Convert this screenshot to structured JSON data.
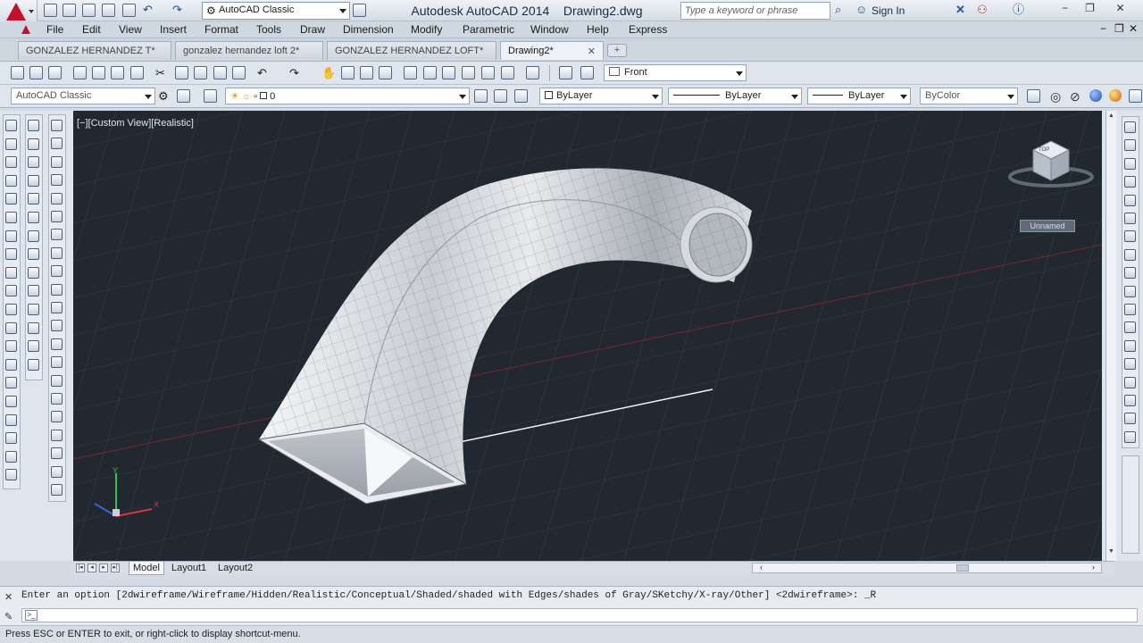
{
  "title_bar": {
    "workspace": "AutoCAD Classic",
    "app_name": "Autodesk AutoCAD 2014",
    "document": "Drawing2.dwg",
    "search_placeholder": "Type a keyword or phrase",
    "sign_in": "Sign In"
  },
  "menu": [
    "File",
    "Edit",
    "View",
    "Insert",
    "Format",
    "Tools",
    "Draw",
    "Dimension",
    "Modify",
    "Parametric",
    "Window",
    "Help",
    "Express"
  ],
  "doc_tabs": [
    {
      "label": "GONZALEZ HERNANDEZ T*",
      "active": false
    },
    {
      "label": "gonzalez hernandez loft 2*",
      "active": false
    },
    {
      "label": "GONZALEZ HERNANDEZ LOFT*",
      "active": false
    },
    {
      "label": "Drawing2*",
      "active": true
    }
  ],
  "toolbar1": {
    "view_select": "Front"
  },
  "toolbar2": {
    "workspace": "AutoCAD Classic",
    "layer": "0",
    "color": "ByLayer",
    "linetype": "ByLayer",
    "lineweight": "ByLayer",
    "plotstyle": "ByColor"
  },
  "viewport": {
    "label": "[−][Custom View][Realistic]",
    "viewcube_face": "TOP",
    "ucs_badge": "Unnamed",
    "axes": {
      "x": "X",
      "y": "Y"
    }
  },
  "layout_tabs": [
    "Model",
    "Layout1",
    "Layout2"
  ],
  "command": {
    "history": "Enter an option [2dwireframe/Wireframe/Hidden/Realistic/Conceptual/Shaded/shaded with Edges/shades of Gray/SKetchy/X-ray/Other] <2dwireframe>: _R",
    "input": ""
  },
  "status_text": "Press ESC or ENTER to exit, or right-click to display shortcut-menu.",
  "colors": {
    "viewport_bg": "#212830",
    "accent": "#c8102e",
    "grid": "#3a4552"
  }
}
